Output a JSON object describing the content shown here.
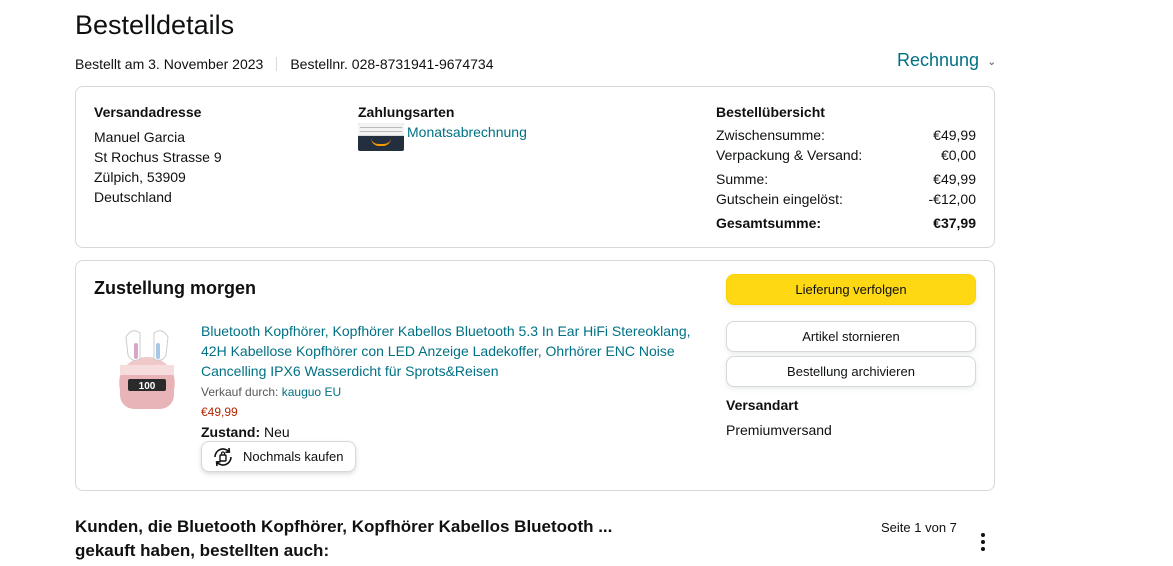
{
  "page": {
    "title": "Bestelldetails",
    "order_date": "Bestellt am 3. November 2023",
    "order_number": "Bestellnr. 028-8731941-9674734",
    "invoice_label": "Rechnung"
  },
  "shipping_address": {
    "heading": "Versandadresse",
    "lines": [
      "Manuel Garcia",
      "St Rochus Strasse 9",
      "Zülpich, 53909",
      "Deutschland"
    ]
  },
  "payment": {
    "heading": "Zahlungsarten",
    "method": "Monatsabrechnung"
  },
  "order_summary": {
    "heading": "Bestellübersicht",
    "rows": [
      {
        "label": "Zwischensumme:",
        "value": "€49,99"
      },
      {
        "label": "Verpackung & Versand:",
        "value": "€0,00"
      },
      {
        "label": "Summe:",
        "value": "€49,99"
      },
      {
        "label": "Gutschein eingelöst:",
        "value": "-€12,00"
      },
      {
        "label": "Gesamtsumme:",
        "value": "€37,99"
      }
    ]
  },
  "delivery": {
    "title": "Zustellung morgen",
    "product": {
      "title": "Bluetooth Kopfhörer, Kopfhörer Kabellos Bluetooth 5.3 In Ear HiFi Stereoklang, 42H Kabellose Kopfhörer con LED Anzeige Ladekoffer, Ohrhörer ENC Noise Cancelling IPX6 Wasserdicht für Sprots&Reisen",
      "seller_label": "Verkauf durch:",
      "seller_name": "kauguo EU",
      "price": "€49,99",
      "condition_label": "Zustand:",
      "condition_value": "Neu",
      "image_display": "100",
      "buy_again_label": "Nochmals kaufen"
    },
    "actions": {
      "track": "Lieferung verfolgen",
      "cancel": "Artikel stornieren",
      "archive": "Bestellung archivieren"
    },
    "shipping_method_heading": "Versandart",
    "shipping_method_value": "Premiumversand"
  },
  "recommendations": {
    "title_line1": "Kunden, die Bluetooth Kopfhörer, Kopfhörer Kabellos Bluetooth ...",
    "title_line2": "gekauft haben, bestellten auch:",
    "pager": "Seite 1 von 7"
  },
  "colors": {
    "link": "#007185",
    "primary_button": "#ffd814",
    "price": "#b12704",
    "border": "#d5d9d9"
  }
}
